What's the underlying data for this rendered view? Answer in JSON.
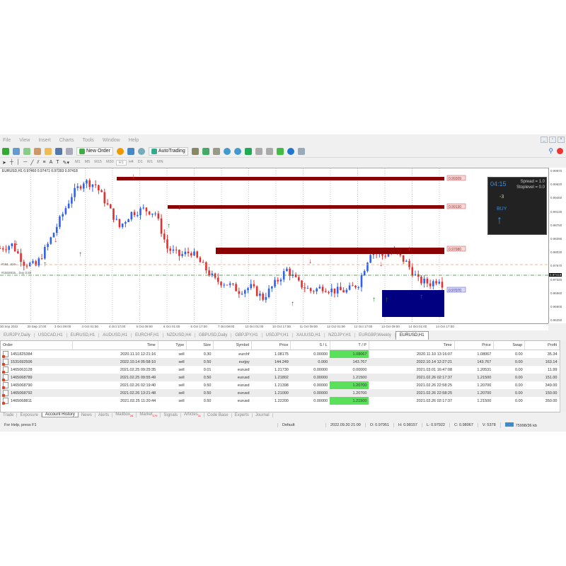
{
  "menu": [
    "File",
    "View",
    "Insert",
    "Charts",
    "Tools",
    "Window",
    "Help"
  ],
  "toolbar": {
    "new_order": "New Order",
    "autotrading": "AutoTrading"
  },
  "timeframes": [
    "M1",
    "M5",
    "M15",
    "M30",
    "H1",
    "H4",
    "D1",
    "W1",
    "MN"
  ],
  "active_timeframe": "H1",
  "chart": {
    "header": "EURUSD,H1  0.97460 0.97471 0.97393 0.97418",
    "price_axis": [
      "0.99970",
      "0.99620",
      "0.99460",
      "0.99130",
      "0.98750",
      "0.98390",
      "0.98030",
      "0.97670",
      "0.97320",
      "0.96960",
      "0.96600",
      "0.96250"
    ],
    "current_price": "0.97418",
    "time_axis": [
      "30 Sep 2022",
      "30 Sep 17:00",
      "3 Oct 09:00",
      "4 Oct 01:00",
      "4 Oct 17:00",
      "5 Oct 09:00",
      "6 Oct 01:00",
      "6 Oct 17:00",
      "7 Oct 09:00",
      "10 Oct 01:00",
      "10 Oct 17:00",
      "11 Oct 09:00",
      "12 Oct 01:00",
      "12 Oct 17:00",
      "13 Oct 09:00",
      "14 Oct 01:00",
      "14 Oct 17:00"
    ],
    "level_labels": [
      "0.99309",
      "0.99130",
      "0.97980",
      "0.97070"
    ],
    "order_lines": [
      "#151..216 ...",
      "#1502815... buy 0.50"
    ],
    "closes": [
      0.9805,
      0.9814,
      0.9769,
      0.9761,
      0.9814,
      0.9875,
      0.9937,
      0.9972,
      0.9963,
      0.9911,
      0.9858,
      0.9893,
      0.9902,
      0.9893,
      0.9805,
      0.9787,
      0.9796,
      0.9761,
      0.9725,
      0.9717,
      0.9699,
      0.9708,
      0.9681,
      0.9717,
      0.9752,
      0.9717,
      0.9699,
      0.9708,
      0.9699,
      0.9699,
      0.9717,
      0.9796,
      0.9787,
      0.9796,
      0.9769,
      0.9725,
      0.9717,
      0.9734
    ],
    "panel": {
      "time": "04:15",
      "spread": "Spread = 1.0",
      "stoplevel": "Stoplevel = 0.0",
      "value": "-3",
      "signal": "BUY"
    }
  },
  "chart_tabs": [
    "EURJPY,Daily",
    "USDCAD,H1",
    "EURUSD,H1",
    "AUDUSD,H1",
    "EURCHF,H1",
    "NZDUSD,H4",
    "GBPUSD,Daily",
    "GBPJPY,H1",
    "USDJPY,H1",
    "XAUUSD,H1",
    "NZDJPY,H1",
    "EURGBP,Weekly",
    "EURUSD,H1"
  ],
  "terminal": {
    "columns": [
      "Order",
      "Time",
      "Type",
      "Size",
      "Symbol",
      "Price",
      "S / L",
      "T / P",
      "Time",
      "Price",
      "Swap",
      "Profit"
    ],
    "rows": [
      [
        "1451825384",
        "2020.11.10 12:21:16",
        "sell",
        "0.30",
        "eurchf",
        "1.08175",
        "0.00000",
        "1.08067",
        "2020.11.10 13:16:07",
        "1.08067",
        "0.00",
        "35.34"
      ],
      [
        "1531692506",
        "2022.10.14 05:58:10",
        "sell",
        "0.50",
        "eurjpy",
        "144.249",
        "0.000",
        "143.767",
        "2022.10.14 12:27:21",
        "143.767",
        "0.00",
        "163.14"
      ],
      [
        "1465063128",
        "2021.02.25 09:25:35",
        "sell",
        "0.01",
        "eurusd",
        "1.21730",
        "0.00000",
        "0.00000",
        "2021.03.01 16:47:08",
        "1.20531",
        "0.00",
        "11.99"
      ],
      [
        "1465068789",
        "2021.02.25 09:55:49",
        "sell",
        "0.50",
        "eurusd",
        "1.21802",
        "0.00000",
        "1.21500",
        "2021.02.26 02:17:37",
        "1.21500",
        "0.00",
        "151.00"
      ],
      [
        "1465068790",
        "2021.02.26 02:19:40",
        "sell",
        "0.50",
        "eurusd",
        "1.21398",
        "0.00000",
        "1.20700",
        "2021.02.26 22:58:25",
        "1.20700",
        "0.00",
        "349.00"
      ],
      [
        "1465068792",
        "2021.02.26 13:21:48",
        "sell",
        "0.50",
        "eurusd",
        "1.21000",
        "0.00000",
        "1.20700",
        "2021.02.26 22:58:25",
        "1.20700",
        "0.00",
        "150.00"
      ],
      [
        "1465068811",
        "2021.02.25 11:20:44",
        "sell",
        "0.50",
        "eurusd",
        "1.22200",
        "0.00000",
        "1.21500",
        "2021.02.26 02:17:37",
        "1.21500",
        "0.00",
        "350.00"
      ]
    ],
    "tp_highlight": [
      true,
      true,
      false,
      true,
      true,
      true,
      true
    ]
  },
  "bottom_tabs": [
    {
      "l": "Trade"
    },
    {
      "l": "Exposure"
    },
    {
      "l": "Account History",
      "on": true
    },
    {
      "l": "News"
    },
    {
      "l": "Alerts"
    },
    {
      "l": "Mailbox",
      "b": "26"
    },
    {
      "l": "Market",
      "b": "179"
    },
    {
      "l": "Signals"
    },
    {
      "l": "Articles",
      "b": "11"
    },
    {
      "l": "Code Base"
    },
    {
      "l": "Experts"
    },
    {
      "l": "Journal"
    }
  ],
  "status": {
    "help": "For Help, press F1",
    "profile": "Default",
    "datetime": "2022.09.30 21:00",
    "open": "O: 0.97951",
    "high": "H: 0.98157",
    "low": "L: 0.97922",
    "close": "C: 0.98067",
    "volume": "V: 5378",
    "traffic": "75998/36 kb"
  }
}
